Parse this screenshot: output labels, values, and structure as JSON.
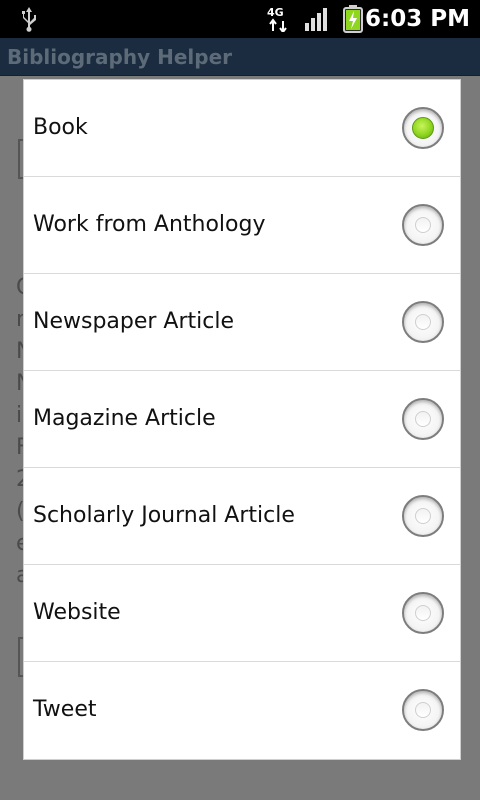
{
  "status_bar": {
    "time": "6:03 PM",
    "network_label": "4G",
    "icons": [
      "usb-icon",
      "4g-network-icon",
      "signal-strength-icon",
      "battery-charging-icon"
    ]
  },
  "app": {
    "title": "Bibliography Helper"
  },
  "background_fragments": [
    "C",
    "n",
    "N",
    "N",
    "i",
    "F",
    "2",
    "(",
    "e",
    "a"
  ],
  "dialog": {
    "options": [
      {
        "label": "Book",
        "selected": true
      },
      {
        "label": "Work from Anthology",
        "selected": false
      },
      {
        "label": "Newspaper Article",
        "selected": false
      },
      {
        "label": "Magazine Article",
        "selected": false
      },
      {
        "label": "Scholarly Journal Article",
        "selected": false
      },
      {
        "label": "Website",
        "selected": false
      },
      {
        "label": "Tweet",
        "selected": false
      }
    ]
  },
  "colors": {
    "status_bar": "#000000",
    "title_bar": "#1b2c40",
    "dim_overlay": "#7a7a7a",
    "radio_selected": "#8fd61f"
  }
}
